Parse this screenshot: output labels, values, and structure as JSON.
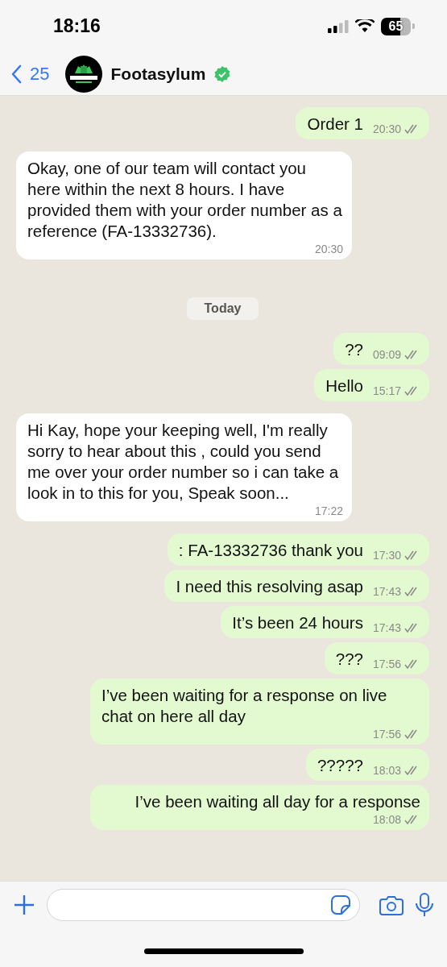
{
  "status_bar": {
    "time": "18:16",
    "battery": "65"
  },
  "header": {
    "back_count": "25",
    "contact_name": "Footasylum",
    "verified": true
  },
  "messages": [
    {
      "kind": "outgoing",
      "text": "Order 1",
      "time": "20:30",
      "read": false
    },
    {
      "kind": "incoming",
      "text": "Okay, one of our team will contact you here within the next 8 hours. I have provided them with your order number as a reference (FA-13332736).",
      "time": "20:30"
    },
    {
      "kind": "date",
      "text": "Today"
    },
    {
      "kind": "outgoing",
      "text": "??",
      "time": "09:09",
      "read": false
    },
    {
      "kind": "outgoing",
      "text": "Hello",
      "time": "15:17",
      "read": false
    },
    {
      "kind": "incoming",
      "text": "Hi Kay, hope your keeping well, I'm really sorry to hear about this , could you send me over your order number so i can take a look in to this for you, Speak soon...",
      "time": "17:22"
    },
    {
      "kind": "outgoing",
      "text": ": FA-13332736 thank you",
      "time": "17:30",
      "read": false
    },
    {
      "kind": "outgoing",
      "text": "I need this resolving asap",
      "time": "17:43",
      "read": false
    },
    {
      "kind": "outgoing",
      "text": "It’s been 24 hours",
      "time": "17:43",
      "read": false
    },
    {
      "kind": "outgoing",
      "text": "???",
      "time": "17:56",
      "read": false
    },
    {
      "kind": "outgoing",
      "text": "I’ve been waiting for a response on live chat on here all day",
      "time": "17:56",
      "read": false
    },
    {
      "kind": "outgoing",
      "text": "?????",
      "time": "18:03",
      "read": false
    },
    {
      "kind": "outgoing",
      "text": "I’ve been waiting all day for a response",
      "time": "18:08",
      "read": false
    }
  ]
}
